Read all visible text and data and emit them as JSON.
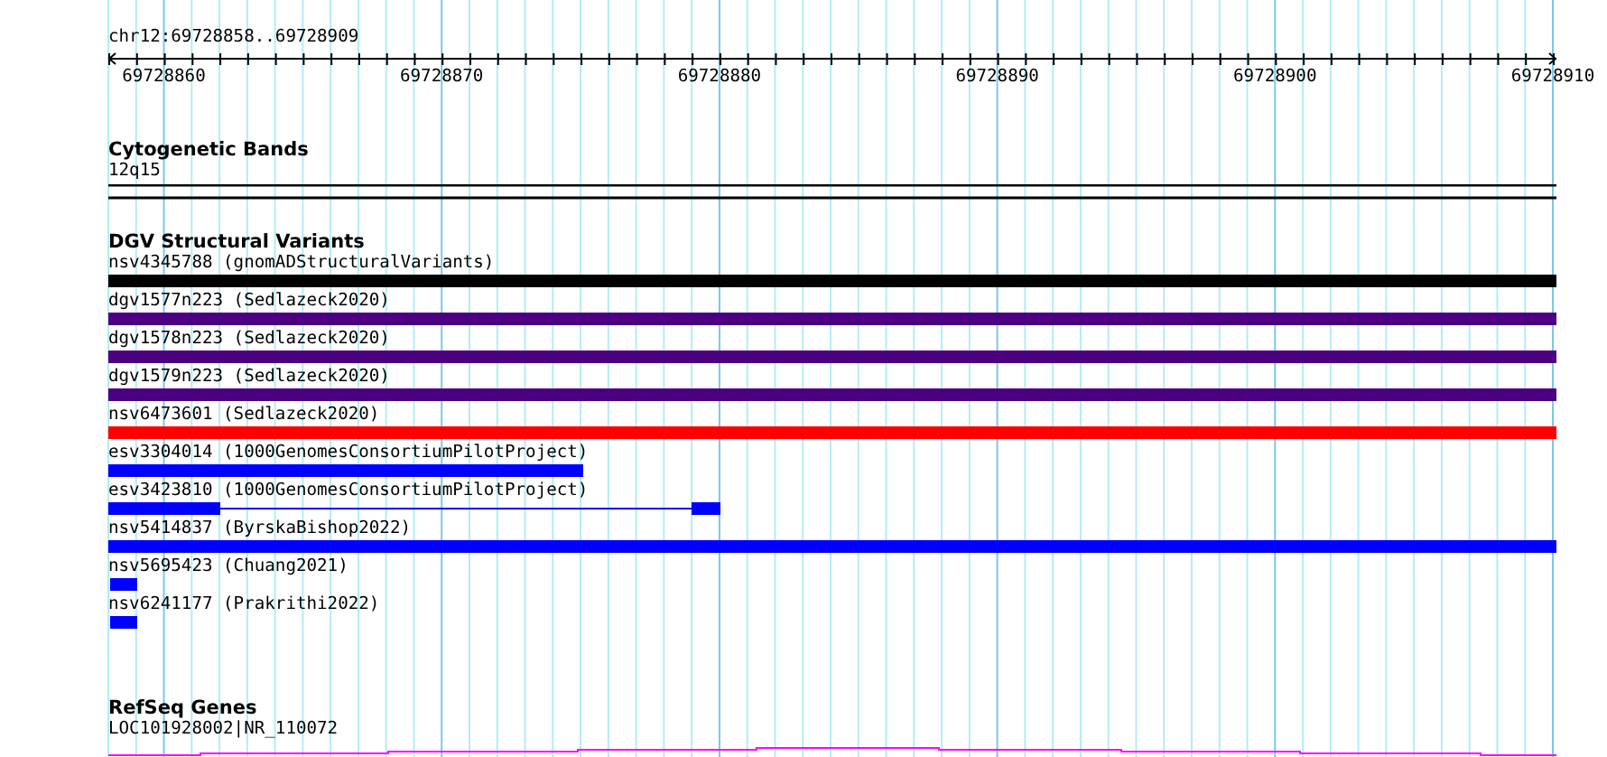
{
  "location": "chr12:69728858..69728909",
  "ruler": {
    "labels": [
      "69728860",
      "69728870",
      "69728880",
      "69728890",
      "69728900",
      "69728910"
    ]
  },
  "tracks": [
    {
      "kind": "cytoband",
      "title": "Cytogenetic Bands",
      "features": [
        {
          "label": "12q15",
          "kind": "band"
        }
      ]
    },
    {
      "kind": "variants",
      "title": "DGV Structural Variants",
      "features": [
        {
          "label": "nsv4345788 (gnomADStructuralVariants)",
          "kind": "full",
          "color": "#000000"
        },
        {
          "label": "dgv1577n223 (Sedlazeck2020)",
          "kind": "full",
          "color": "#4b0082"
        },
        {
          "label": "dgv1578n223 (Sedlazeck2020)",
          "kind": "full",
          "color": "#4b0082"
        },
        {
          "label": "dgv1579n223 (Sedlazeck2020)",
          "kind": "full",
          "color": "#4b0082"
        },
        {
          "label": "nsv6473601 (Sedlazeck2020)",
          "kind": "full",
          "color": "#ff0000"
        },
        {
          "label": "esv3304014 (1000GenomesConsortiumPilotProject)",
          "kind": "partial",
          "color": "#0000ff"
        },
        {
          "label": "esv3423810 (1000GenomesConsortiumPilotProject)",
          "kind": "split",
          "color": "#0000ff"
        },
        {
          "label": "nsv5414837 (ByrskaBishop2022)",
          "kind": "full",
          "color": "#0000ff"
        },
        {
          "label": "nsv5695423 (Chuang2021)",
          "kind": "stub",
          "color": "#0000ff"
        },
        {
          "label": "nsv6241177 (Prakrithi2022)",
          "kind": "stub",
          "color": "#0000ff"
        }
      ]
    },
    {
      "kind": "genes",
      "title": "RefSeq Genes",
      "features": [
        {
          "label": "LOC101928002|NR_110072",
          "kind": "gene"
        }
      ]
    }
  ]
}
